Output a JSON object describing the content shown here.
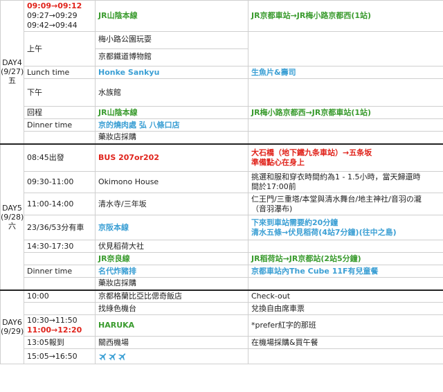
{
  "day4": {
    "label": [
      "DAY4",
      "(9/27)",
      "五"
    ],
    "rows": [
      {
        "time": [
          {
            "text": "09:09→09:12",
            "style": "red"
          },
          {
            "text": "09:27→09:29",
            "style": "plain"
          },
          {
            "text": "09:42→09:44",
            "style": "plain"
          }
        ],
        "place": {
          "text": "JR山陰本線",
          "style": "green"
        },
        "note": [
          {
            "text": "JR京都車站→JR梅小路京都西(1站)",
            "style": "green"
          }
        ]
      },
      {
        "time": [
          {
            "text": "上午",
            "style": "plain"
          }
        ],
        "place_lines": [
          "梅小路公園玩耍",
          "京都鐵道博物館"
        ],
        "note": []
      },
      {
        "time": [
          {
            "text": "Lunch time",
            "style": "plain"
          }
        ],
        "place": {
          "text": "Honke Sankyu",
          "style": "blue"
        },
        "note": [
          {
            "text": "生魚片&壽司",
            "style": "blue"
          }
        ]
      },
      {
        "time": [
          {
            "text": "下午",
            "style": "plain"
          }
        ],
        "place": {
          "text": "水族館",
          "style": "plain"
        },
        "note": []
      },
      {
        "time": [
          {
            "text": "回程",
            "style": "plain"
          }
        ],
        "place": {
          "text": "JR山陰本線",
          "style": "green"
        },
        "note": [
          {
            "text": "JR梅小路京都西→JR京都車站(1站)",
            "style": "green"
          }
        ]
      },
      {
        "time": [
          {
            "text": "Dinner time",
            "style": "plain"
          }
        ],
        "place": {
          "text": "京的燒肉處 弘 八條口店",
          "style": "blue"
        },
        "note": []
      },
      {
        "time": [],
        "place": {
          "text": "藥妝店採購",
          "style": "plain"
        },
        "note": []
      }
    ]
  },
  "day5": {
    "label": [
      "DAY5",
      "(9/28)",
      "六"
    ],
    "rows": [
      {
        "time": [
          {
            "text": "08:45出發",
            "style": "plain"
          }
        ],
        "place": {
          "text": "BUS 207or202",
          "style": "red"
        },
        "note": [
          {
            "text": "大石橋（地下鐵九条車站）→五条坂",
            "style": "red"
          },
          {
            "text": "準備點心在身上",
            "style": "red"
          }
        ]
      },
      {
        "time": [
          {
            "text": "09:30-11:00",
            "style": "plain"
          }
        ],
        "place": {
          "text": "Okimono House",
          "style": "plain"
        },
        "note": [
          {
            "text": "挑選和服和穿衣時間約為1 - 1.5小時，當天歸還時",
            "style": "plain"
          },
          {
            "text": "間於17:00前",
            "style": "plain"
          }
        ]
      },
      {
        "time": [
          {
            "text": "11:00-14:00",
            "style": "plain"
          }
        ],
        "place": {
          "text": "清水寺/三年坂",
          "style": "plain"
        },
        "note": [
          {
            "text": "仁王門/三重塔/本堂與清水舞台/地主神社/音羽の瀧",
            "style": "plain"
          },
          {
            "text": "（音羽瀑布)",
            "style": "plain"
          }
        ]
      },
      {
        "time": [
          {
            "text": "23/36/53分有車",
            "style": "plain"
          }
        ],
        "place": {
          "text": "京阪本線",
          "style": "blue"
        },
        "note": [
          {
            "text": "下來到車站需要約20分鐘",
            "style": "blue"
          },
          {
            "text": "清水五條→伏見稻荷(4站7分鐘)(往中之島)",
            "style": "blue"
          }
        ]
      },
      {
        "time": [
          {
            "text": "14:30-17:30",
            "style": "plain"
          }
        ],
        "place": {
          "text": "伏見稻荷大社",
          "style": "plain"
        },
        "note": []
      },
      {
        "time": [],
        "place": {
          "text": "JR奈良線",
          "style": "green"
        },
        "note": [
          {
            "text": "JR稻荷站→JR京都站(2站5分鐘)",
            "style": "green"
          }
        ]
      },
      {
        "time": [
          {
            "text": "Dinner time",
            "style": "plain"
          }
        ],
        "place": {
          "text": "名代炸豬排",
          "style": "blue"
        },
        "note": [
          {
            "text": "京都車站內The Cube 11F有兒童餐",
            "style": "blue"
          }
        ]
      },
      {
        "time": [],
        "place": {
          "text": "藥妝店採購",
          "style": "plain"
        },
        "note": []
      }
    ]
  },
  "day6": {
    "label": [
      "DAY6",
      "(9/29)"
    ],
    "rows": [
      {
        "time": [
          {
            "text": "10:00",
            "style": "plain"
          }
        ],
        "place": {
          "text": "京都格蘭比亞比偲奇飯店",
          "style": "plain"
        },
        "note": [
          {
            "text": "Check-out",
            "style": "plain"
          }
        ]
      },
      {
        "time": [],
        "place": {
          "text": "找綠色機台",
          "style": "plain"
        },
        "note": [
          {
            "text": "兌換自由席車票",
            "style": "plain"
          }
        ]
      },
      {
        "time": [
          {
            "text": "10:30→11:50",
            "style": "plain"
          },
          {
            "text": "11:00→12:20",
            "style": "red"
          }
        ],
        "place": {
          "text": "HARUKA",
          "style": "green"
        },
        "note": [
          {
            "text": "*prefer紅字的那班",
            "style": "plain"
          }
        ]
      },
      {
        "time": [
          {
            "text": "13:05報到",
            "style": "plain"
          }
        ],
        "place": {
          "text": "關西機場",
          "style": "plain"
        },
        "note": [
          {
            "text": "在機場採購&買午餐",
            "style": "plain"
          }
        ]
      },
      {
        "time": [
          {
            "text": "15:05→16:50",
            "style": "plain"
          }
        ],
        "place": {
          "text": "",
          "style": "plain"
        },
        "planes": 3,
        "note": []
      }
    ]
  }
}
